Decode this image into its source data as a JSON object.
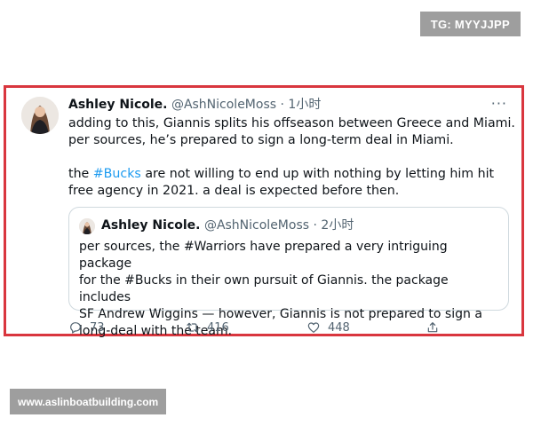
{
  "watermark_top": "TG: MYYJJPP",
  "watermark_bottom": "www.aslinboatbuilding.com",
  "tweet": {
    "name": "Ashley Nicole.",
    "handle": "@AshNicoleMoss",
    "separator": "·",
    "time": "1小时",
    "more_icon": "···",
    "line1": "adding to this, Giannis splits his offseason between Greece and Miami.",
    "line2": "per sources, he’s prepared to sign a long-term deal in Miami.",
    "line3_prefix": "the ",
    "line3_hashtag": "#Bucks",
    "line3_suffix": " are not willing to end up with nothing by letting him hit",
    "line4": "free agency in 2021. a deal is expected before then."
  },
  "quoted": {
    "name": "Ashley Nicole.",
    "handle": "@AshNicoleMoss",
    "separator": "·",
    "time": "2小时",
    "line1": "per sources, the #Warriors have prepared a very intriguing package",
    "line2": "for the #Bucks in their own pursuit of Giannis. the package includes",
    "line3": "SF Andrew Wiggins — however, Giannis is not prepared to sign a",
    "line4": "long-deal with the team."
  },
  "actions": {
    "replies": "73",
    "retweets": "416",
    "likes": "448"
  },
  "colors": {
    "frame": "#d9363e",
    "hashtag": "#1d9bf0",
    "muted": "#536471",
    "badge": "#9e9e9e"
  }
}
